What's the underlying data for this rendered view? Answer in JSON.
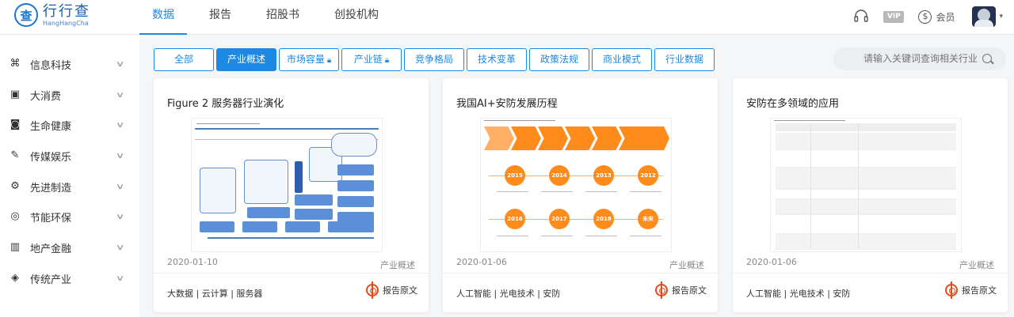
{
  "brand": {
    "name_cn": "行行查",
    "name_en": "HangHangCha",
    "mark": "查"
  },
  "nav": [
    {
      "label": "数据",
      "active": true
    },
    {
      "label": "报告",
      "active": false
    },
    {
      "label": "招股书",
      "active": false
    },
    {
      "label": "创投机构",
      "active": false
    }
  ],
  "header_right": {
    "vip": "VIP",
    "member": "会员",
    "coin_symbol": "$",
    "caret": "▾"
  },
  "sidebar": [
    {
      "label": "信息科技",
      "icon": "⌘"
    },
    {
      "label": "大消费",
      "icon": "▣"
    },
    {
      "label": "生命健康",
      "icon": "◙"
    },
    {
      "label": "传媒娱乐",
      "icon": "✎"
    },
    {
      "label": "先进制造",
      "icon": "⚙"
    },
    {
      "label": "节能环保",
      "icon": "◎"
    },
    {
      "label": "地产金融",
      "icon": "▥"
    },
    {
      "label": "传统产业",
      "icon": "◈"
    }
  ],
  "tabs": [
    {
      "label": "全部",
      "active": false,
      "locked": false
    },
    {
      "label": "产业概述",
      "active": true,
      "locked": false
    },
    {
      "label": "市场容量",
      "active": false,
      "locked": true
    },
    {
      "label": "产业链",
      "active": false,
      "locked": true
    },
    {
      "label": "竞争格局",
      "active": false,
      "locked": false
    },
    {
      "label": "技术变革",
      "active": false,
      "locked": false
    },
    {
      "label": "政策法规",
      "active": false,
      "locked": false
    },
    {
      "label": "商业模式",
      "active": false,
      "locked": false
    },
    {
      "label": "行业数据",
      "active": false,
      "locked": false
    }
  ],
  "search": {
    "placeholder": "请输入关键词查询相关行业"
  },
  "cards": [
    {
      "title": "Figure 2 服务器行业演化",
      "date": "2020-01-10",
      "category": "产业概述",
      "tags": "大数据 | 云计算 | 服务器",
      "report_label": "报告原文"
    },
    {
      "title": "我国AI+安防发展历程",
      "date": "2020-01-06",
      "category": "产业概述",
      "tags": "人工智能 | 光电技术 | 安防",
      "report_label": "报告原文"
    },
    {
      "title": "安防在多领域的应用",
      "date": "2020-01-06",
      "category": "产业概述",
      "tags": "人工智能 | 光电技术 | 安防",
      "report_label": "报告原文"
    }
  ],
  "thumb2": {
    "years": [
      "2015",
      "2014",
      "2013",
      "2012",
      "2016",
      "2017",
      "2018",
      "未来"
    ]
  },
  "colors": {
    "accent": "#1e88e5",
    "orange": "#ff8c1a",
    "report_red": "#e64a19"
  }
}
